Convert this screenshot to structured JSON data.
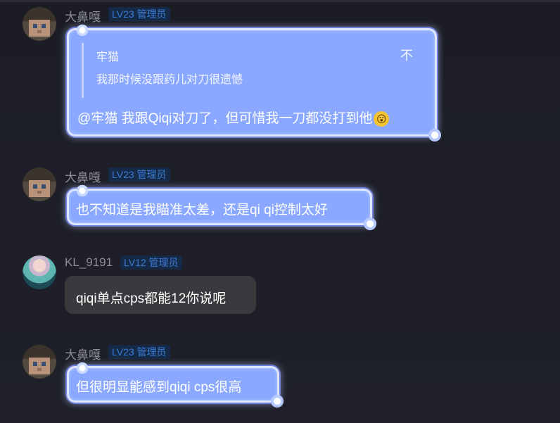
{
  "messages": [
    {
      "user": "大鼻嘎",
      "level": "LV23 管理员",
      "quote": {
        "name": "牢猫",
        "text": "我那时候没跟药儿对刀很遗憾",
        "close": "不"
      },
      "text": "@牢猫 我跟Qiqi对刀了，但可惜我一刀都没打到他",
      "emoji": "😮"
    },
    {
      "user": "大鼻嘎",
      "level": "LV23 管理员",
      "text": "也不知道是我瞄准太差，还是qi qi控制太好"
    },
    {
      "user": "KL_9191",
      "level": "LV12 管理员",
      "text": "qiqi单点cps都能12你说呢"
    },
    {
      "user": "大鼻嘎",
      "level": "LV23 管理员",
      "text": "但很明显能感到qiqi cps很高"
    }
  ],
  "colors": {
    "bubble_fancy": "#8aa8ff",
    "bubble_dark": "#3a3a3e",
    "badge_text": "#3d7ad6",
    "name_text": "#8c8d96"
  }
}
